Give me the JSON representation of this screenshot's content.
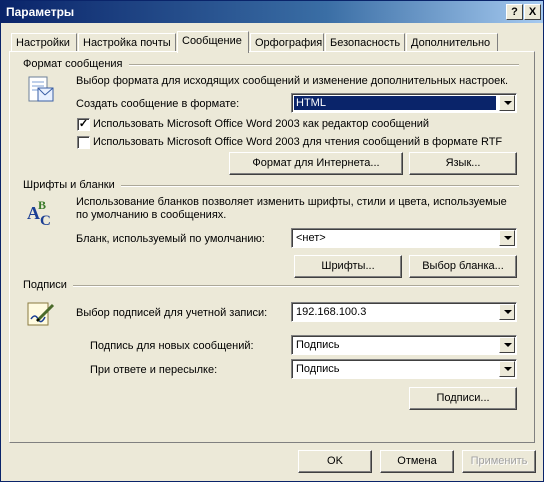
{
  "window": {
    "title": "Параметры",
    "help_label": "?",
    "close_label": "X"
  },
  "tabs": [
    {
      "label": "Настройки"
    },
    {
      "label": "Настройка почты"
    },
    {
      "label": "Сообщение"
    },
    {
      "label": "Орфография"
    },
    {
      "label": "Безопасность"
    },
    {
      "label": "Дополнительно"
    }
  ],
  "format_section": {
    "title": "Формат сообщения",
    "description": "Выбор формата для исходящих сообщений и изменение дополнительных настроек.",
    "create_label": "Создать сообщение в формате:",
    "create_value": "HTML",
    "check_word_editor": {
      "label": "Использовать Microsoft Office Word 2003 как редактор сообщений",
      "checked": true
    },
    "check_word_rtf": {
      "label": "Использовать Microsoft Office Word 2003 для чтения сообщений в формате RTF",
      "checked": false
    },
    "internet_format_button": "Формат для Интернета...",
    "language_button": "Язык..."
  },
  "fonts_section": {
    "title": "Шрифты и бланки",
    "description_line1": "Использование бланков позволяет изменить шрифты, стили и цвета, используемые",
    "description_line2": "по умолчанию в сообщениях.",
    "default_label": "Бланк, используемый по умолчанию:",
    "default_value": "<нет>",
    "fonts_button": "Шрифты...",
    "choose_button": "Выбор бланка..."
  },
  "signatures_section": {
    "title": "Подписи",
    "account_label": "Выбор подписей для учетной записи:",
    "account_value": "192.168.100.3",
    "new_label": "Подпись для новых сообщений:",
    "new_value": "Подпись",
    "reply_label": "При ответе и пересылке:",
    "reply_value": "Подпись",
    "signatures_button": "Подписи..."
  },
  "footer": {
    "ok": "OK",
    "cancel": "Отмена",
    "apply": "Применить"
  },
  "colors": {
    "selection": "#0a246a",
    "dialog_bg": "#ece9d8"
  }
}
